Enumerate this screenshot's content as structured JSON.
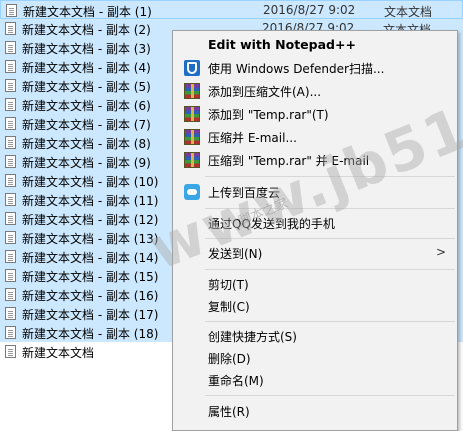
{
  "files": [
    {
      "name": "新建文本文档 - 副本 (1)",
      "date": "2016/8/27 9:02",
      "type": "文本文档"
    },
    {
      "name": "新建文本文档 - 副本 (2)",
      "date": "2016/8/27 9:02",
      "type": "文本文档"
    },
    {
      "name": "新建文本文档 - 副本 (3)",
      "date": "",
      "type": ""
    },
    {
      "name": "新建文本文档 - 副本 (4)",
      "date": "",
      "type": ""
    },
    {
      "name": "新建文本文档 - 副本 (5)",
      "date": "",
      "type": ""
    },
    {
      "name": "新建文本文档 - 副本 (6)",
      "date": "",
      "type": ""
    },
    {
      "name": "新建文本文档 - 副本 (7)",
      "date": "",
      "type": ""
    },
    {
      "name": "新建文本文档 - 副本 (8)",
      "date": "",
      "type": ""
    },
    {
      "name": "新建文本文档 - 副本 (9)",
      "date": "",
      "type": ""
    },
    {
      "name": "新建文本文档 - 副本 (10)",
      "date": "",
      "type": ""
    },
    {
      "name": "新建文本文档 - 副本 (11)",
      "date": "",
      "type": ""
    },
    {
      "name": "新建文本文档 - 副本 (12)",
      "date": "",
      "type": ""
    },
    {
      "name": "新建文本文档 - 副本 (13)",
      "date": "",
      "type": ""
    },
    {
      "name": "新建文本文档 - 副本 (14)",
      "date": "",
      "type": ""
    },
    {
      "name": "新建文本文档 - 副本 (15)",
      "date": "",
      "type": ""
    },
    {
      "name": "新建文本文档 - 副本 (16)",
      "date": "",
      "type": ""
    },
    {
      "name": "新建文本文档 - 副本 (17)",
      "date": "",
      "type": ""
    },
    {
      "name": "新建文本文档 - 副本 (18)",
      "date": "",
      "type": ""
    },
    {
      "name": "新建文本文档",
      "date": "",
      "type": ""
    }
  ],
  "context_menu": {
    "items": [
      {
        "label": "Edit with Notepad++",
        "icon": "notepad-plus-icon"
      },
      {
        "label": "使用 Windows Defender扫描...",
        "icon": "windows-defender-icon"
      },
      {
        "label": "添加到压缩文件(A)...",
        "icon": "winrar-icon"
      },
      {
        "label": "添加到 \"Temp.rar\"(T)",
        "icon": "winrar-icon"
      },
      {
        "label": "压缩并 E-mail...",
        "icon": "winrar-icon"
      },
      {
        "label": "压缩到 \"Temp.rar\" 并 E-mail",
        "icon": "winrar-icon"
      },
      {
        "label": "上传到百度云",
        "icon": "baidu-cloud-icon"
      },
      {
        "label": "通过QQ发送到我的手机",
        "icon": ""
      },
      {
        "label": "发送到(N)",
        "icon": "",
        "submenu_arrow": ">"
      },
      {
        "label": "剪切(T)",
        "icon": ""
      },
      {
        "label": "复制(C)",
        "icon": ""
      },
      {
        "label": "创建快捷方式(S)",
        "icon": ""
      },
      {
        "label": "删除(D)",
        "icon": ""
      },
      {
        "label": "重命名(M)",
        "icon": ""
      },
      {
        "label": "属性(R)",
        "icon": ""
      }
    ]
  },
  "watermark": {
    "main": "www.jb51.net",
    "sub": "脚本之家"
  },
  "colors": {
    "selection": "#cce8ff",
    "menu_bg": "#f2f2f2"
  }
}
